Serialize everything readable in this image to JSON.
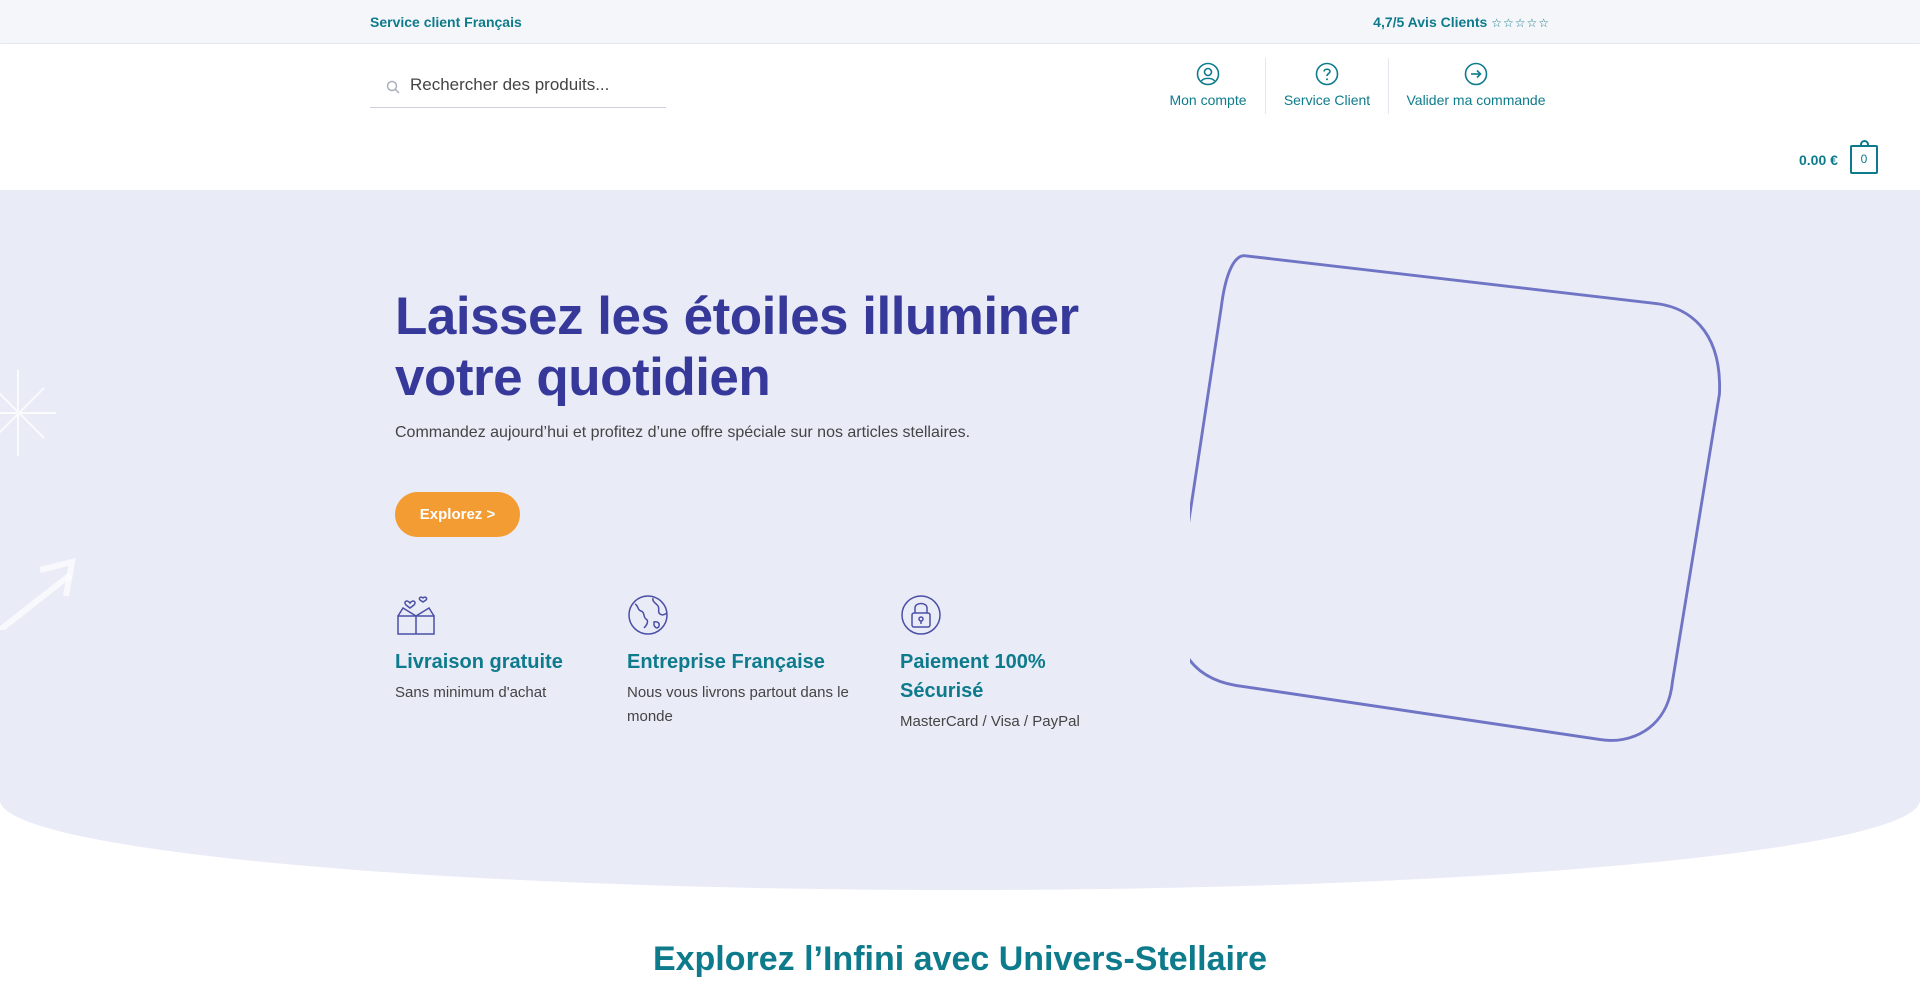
{
  "topbar": {
    "left_text": "Service client Français",
    "rating_text": "4,7/5 Avis Clients",
    "rating_stars": "☆☆☆☆☆"
  },
  "search": {
    "placeholder": "Rechercher des produits..."
  },
  "nav": {
    "account_label": "Mon compte",
    "service_label": "Service Client",
    "checkout_label": "Valider ma commande"
  },
  "cart": {
    "price": "0.00 €",
    "count": "0"
  },
  "hero": {
    "title": "Laissez les étoiles illuminer votre quotidien",
    "subtitle": "Commandez aujourd’hui et profitez d’une offre spéciale sur nos articles stellaires.",
    "cta_label": "Explorez >"
  },
  "features": [
    {
      "title": "Livraison gratuite",
      "text": "Sans minimum d'achat",
      "icon": "gift-box-icon"
    },
    {
      "title": "Entreprise Française",
      "text": "Nous vous livrons partout dans le monde",
      "icon": "globe-icon"
    },
    {
      "title": "Paiement 100% Sécurisé",
      "text": "MasterCard / Visa / PayPal",
      "icon": "padlock-icon"
    }
  ],
  "section": {
    "title": "Explorez l’Infini avec Univers-Stellaire"
  },
  "colors": {
    "accent": "#0e7b8c",
    "heading": "#36399a",
    "cta": "#f39c34",
    "hero_bg": "#e9ebf7"
  }
}
